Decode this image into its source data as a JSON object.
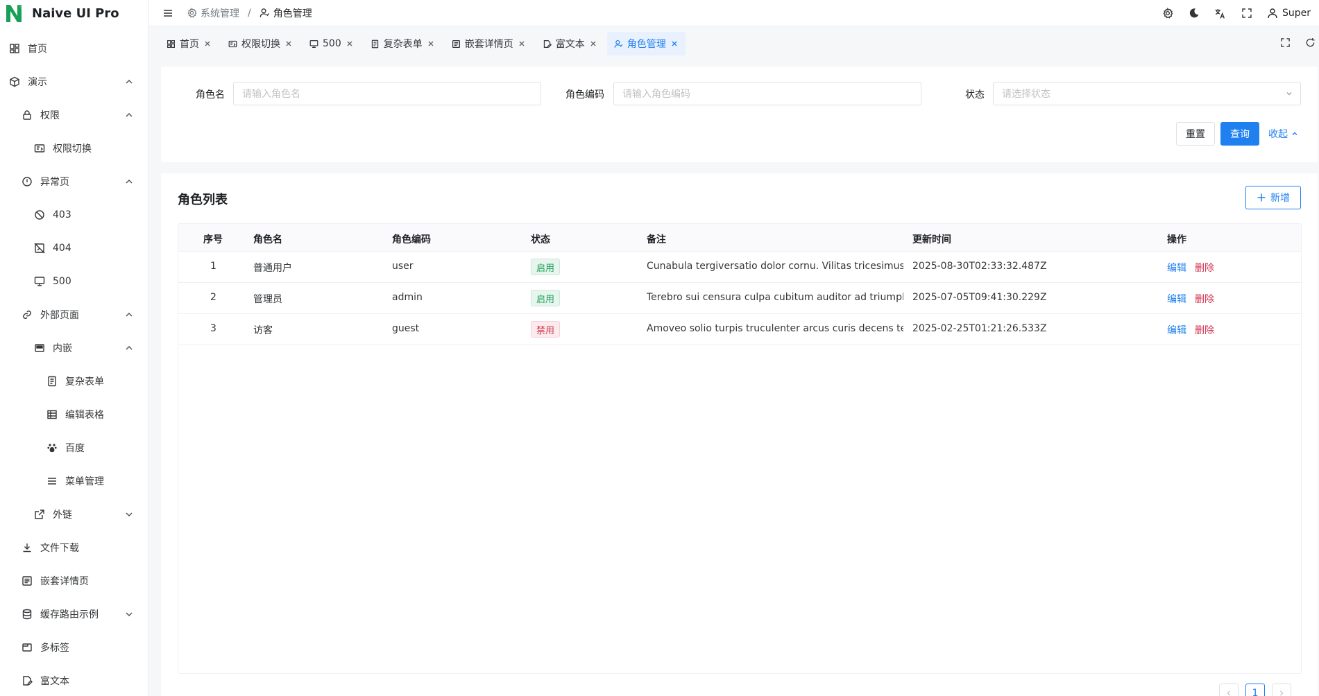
{
  "app": {
    "title": "Naive UI Pro",
    "brand_color": "#18a058",
    "primary_color": "#2080f0"
  },
  "sidebar": {
    "items": [
      {
        "label": "首页",
        "icon": "dashboard-icon"
      },
      {
        "label": "演示",
        "icon": "cube-icon",
        "arrow": "up"
      },
      {
        "label": "权限",
        "icon": "lock-icon",
        "arrow": "up"
      },
      {
        "label": "权限切换",
        "icon": "switch-icon"
      },
      {
        "label": "异常页",
        "icon": "alert-circle-icon",
        "arrow": "up"
      },
      {
        "label": "403",
        "icon": "ban-icon"
      },
      {
        "label": "404",
        "icon": "image-off-icon"
      },
      {
        "label": "500",
        "icon": "monitor-icon"
      },
      {
        "label": "外部页面",
        "icon": "link-icon",
        "arrow": "up"
      },
      {
        "label": "内嵌",
        "icon": "window-icon",
        "arrow": "up"
      },
      {
        "label": "复杂表单",
        "icon": "form-icon"
      },
      {
        "label": "编辑表格",
        "icon": "table-icon"
      },
      {
        "label": "百度",
        "icon": "paw-icon"
      },
      {
        "label": "菜单管理",
        "icon": "menu-icon"
      },
      {
        "label": "外链",
        "icon": "external-link-icon",
        "arrow": "down"
      },
      {
        "label": "文件下载",
        "icon": "download-icon"
      },
      {
        "label": "嵌套详情页",
        "icon": "list-detail-icon"
      },
      {
        "label": "缓存路由示例",
        "icon": "database-icon",
        "arrow": "down"
      },
      {
        "label": "多标签",
        "icon": "tabs-icon"
      },
      {
        "label": "富文本",
        "icon": "edit-doc-icon"
      }
    ]
  },
  "header": {
    "breadcrumb": [
      {
        "label": "系统管理",
        "icon": "gear-icon"
      },
      {
        "label": "角色管理",
        "icon": "user-role-icon"
      }
    ],
    "user_name": "Super"
  },
  "tabs": [
    {
      "label": "首页",
      "icon": "dashboard-icon"
    },
    {
      "label": "权限切换",
      "icon": "switch-icon"
    },
    {
      "label": "500",
      "icon": "monitor-icon"
    },
    {
      "label": "复杂表单",
      "icon": "form-icon"
    },
    {
      "label": "嵌套详情页",
      "icon": "list-detail-icon"
    },
    {
      "label": "富文本",
      "icon": "edit-doc-icon"
    },
    {
      "label": "角色管理",
      "icon": "user-role-icon",
      "active": true
    }
  ],
  "search": {
    "role_name_label": "角色名",
    "role_name_placeholder": "请输入角色名",
    "role_code_label": "角色编码",
    "role_code_placeholder": "请输入角色编码",
    "status_label": "状态",
    "status_placeholder": "请选择状态",
    "reset_label": "重置",
    "query_label": "查询",
    "collapse_label": "收起"
  },
  "table": {
    "title": "角色列表",
    "add_label": "新增",
    "columns": [
      "序号",
      "角色名",
      "角色编码",
      "状态",
      "备注",
      "更新时间",
      "操作"
    ],
    "rows": [
      {
        "index": "1",
        "name": "普通用户",
        "code": "user",
        "status": "启用",
        "status_type": "success",
        "remark": "Cunabula tergiversatio dolor cornu. Vilitas tricesimus ti...",
        "updated": "2025-08-30T02:33:32.487Z",
        "edit": "编辑",
        "delete": "删除"
      },
      {
        "index": "2",
        "name": "管理员",
        "code": "admin",
        "status": "启用",
        "status_type": "success",
        "remark": "Terebro sui censura culpa cubitum auditor ad triumphu...",
        "updated": "2025-07-05T09:41:30.229Z",
        "edit": "编辑",
        "delete": "删除"
      },
      {
        "index": "3",
        "name": "访客",
        "code": "guest",
        "status": "禁用",
        "status_type": "error",
        "remark": "Amoveo solio turpis truculenter arcus curis decens tem...",
        "updated": "2025-02-25T01:21:26.533Z",
        "edit": "编辑",
        "delete": "删除"
      }
    ],
    "pagination": {
      "current_page": "1"
    }
  }
}
